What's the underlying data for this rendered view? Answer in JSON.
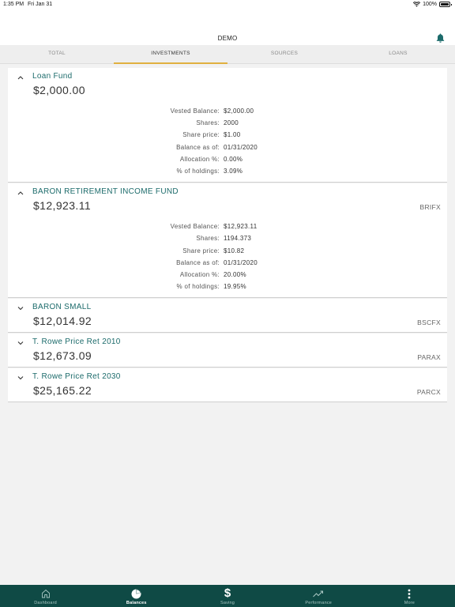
{
  "status_bar": {
    "time": "1:35 PM",
    "date": "Fri Jan 31",
    "battery": "100%"
  },
  "header": {
    "title": "DEMO"
  },
  "tabs": [
    {
      "label": "TOTAL",
      "active": false
    },
    {
      "label": "INVESTMENTS",
      "active": true
    },
    {
      "label": "SOURCES",
      "active": false
    },
    {
      "label": "LOANS",
      "active": false
    }
  ],
  "detail_labels": {
    "vested": "Vested Balance:",
    "shares": "Shares:",
    "price": "Share price:",
    "as_of": "Balance as of:",
    "allocation": "Allocation %:",
    "holdings": "% of holdings:"
  },
  "funds": [
    {
      "name": "Loan Fund",
      "balance": "$2,000.00",
      "ticker": "",
      "expanded": true,
      "details": {
        "vested": "$2,000.00",
        "shares": "2000",
        "price": "$1.00",
        "as_of": "01/31/2020",
        "allocation": "0.00%",
        "holdings": "3.09%"
      }
    },
    {
      "name": "BARON RETIREMENT INCOME FUND",
      "balance": "$12,923.11",
      "ticker": "BRIFX",
      "expanded": true,
      "details": {
        "vested": "$12,923.11",
        "shares": "1194.373",
        "price": "$10.82",
        "as_of": "01/31/2020",
        "allocation": "20.00%",
        "holdings": "19.95%"
      }
    },
    {
      "name": "BARON SMALL",
      "balance": "$12,014.92",
      "ticker": "BSCFX",
      "expanded": false
    },
    {
      "name": "T. Rowe Price Ret 2010",
      "balance": "$12,673.09",
      "ticker": "PARAX",
      "expanded": false
    },
    {
      "name": "T. Rowe Price Ret 2030",
      "balance": "$25,165.22",
      "ticker": "PARCX",
      "expanded": false
    }
  ],
  "bottom_nav": [
    {
      "label": "Dashboard",
      "icon": "home-icon",
      "active": false
    },
    {
      "label": "Balances",
      "icon": "pie-chart-icon",
      "active": true
    },
    {
      "label": "Saving",
      "icon": "dollar-icon",
      "active": false
    },
    {
      "label": "Performance",
      "icon": "trend-icon",
      "active": false
    },
    {
      "label": "More",
      "icon": "more-icon",
      "active": false
    }
  ]
}
